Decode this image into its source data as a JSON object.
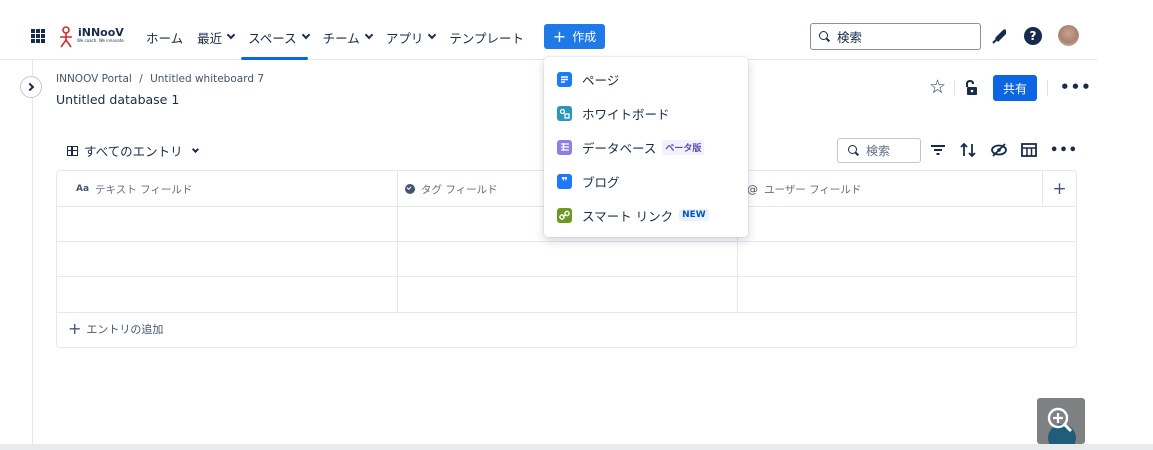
{
  "brand": {
    "name": "iNNooV",
    "tagline": "We coach. We innovate."
  },
  "nav": {
    "items": [
      {
        "label": "ホーム",
        "dropdown": false,
        "active": false
      },
      {
        "label": "最近",
        "dropdown": true,
        "active": false
      },
      {
        "label": "スペース",
        "dropdown": true,
        "active": true
      },
      {
        "label": "チーム",
        "dropdown": true,
        "active": false
      },
      {
        "label": "アプリ",
        "dropdown": true,
        "active": false
      },
      {
        "label": "テンプレート",
        "dropdown": false,
        "active": false
      }
    ],
    "create_label": "作成",
    "search_placeholder": "検索"
  },
  "header": {
    "breadcrumb": [
      "INNOOV Portal",
      "Untitled whiteboard 7"
    ],
    "breadcrumb_sep": "/",
    "title": "Untitled database 1",
    "share_label": "共有"
  },
  "toolbar": {
    "view_label": "すべてのエントリ",
    "search_placeholder": "検索"
  },
  "table": {
    "columns": [
      {
        "icon": "Aa",
        "icon_name": "text-field-icon",
        "label": "テキスト フィールド"
      },
      {
        "icon": "",
        "icon_name": "tag-icon",
        "label": "タグ フィールド"
      },
      {
        "icon": "@",
        "icon_name": "user-icon",
        "label": "ユーザー フィールド"
      }
    ],
    "rows": [
      [
        "",
        "",
        ""
      ],
      [
        "",
        "",
        ""
      ],
      [
        "",
        "",
        ""
      ]
    ],
    "add_entry_label": "エントリの追加"
  },
  "create_menu": {
    "items": [
      {
        "label": "ページ",
        "icon": "page-icon",
        "color": "#1d7afc",
        "badge": ""
      },
      {
        "label": "ホワイトボード",
        "icon": "whiteboard-icon",
        "color": "#2898bd",
        "badge": ""
      },
      {
        "label": "データベース",
        "icon": "database-icon",
        "color": "#8f7ee7",
        "badge": "ベータ版"
      },
      {
        "label": "ブログ",
        "icon": "blog-icon",
        "color": "#1d7afc",
        "badge": ""
      },
      {
        "label": "スマート リンク",
        "icon": "smart-link-icon",
        "color": "#6a9a23",
        "badge": "NEW"
      }
    ]
  },
  "colors": {
    "accent": "#0c66e4",
    "create": "#1f7ae8",
    "text": "#172b4d",
    "subtle": "#626f86"
  }
}
